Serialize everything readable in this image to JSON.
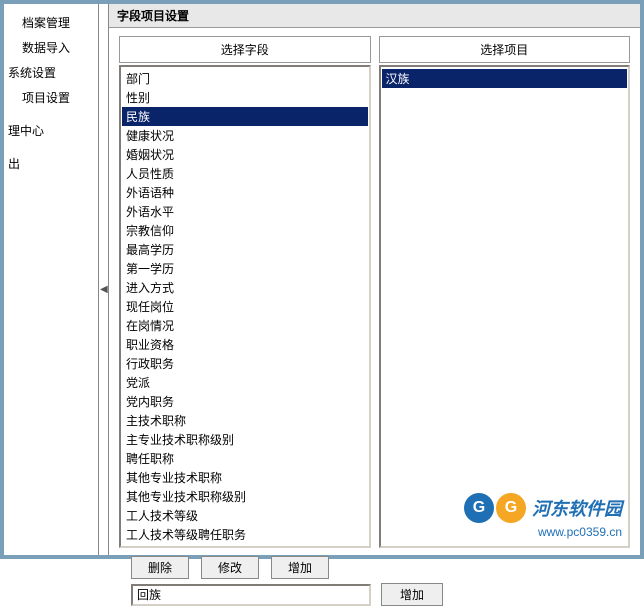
{
  "sidebar": {
    "items": [
      {
        "label": "档案管理",
        "level": 1
      },
      {
        "label": "数据导入",
        "level": 1
      },
      {
        "label": "系统设置",
        "level": 0
      },
      {
        "label": "项目设置",
        "level": 1
      },
      {
        "label": "理中心",
        "level": 0
      },
      {
        "label": "出",
        "level": 0
      }
    ]
  },
  "panel": {
    "title": "字段项目设置"
  },
  "columns": {
    "left_header": "选择字段",
    "right_header": "选择项目"
  },
  "fields": [
    "部门",
    "性别",
    "民族",
    "健康状况",
    "婚姻状况",
    "人员性质",
    "外语语种",
    "外语水平",
    "宗教信仰",
    "最高学历",
    "第一学历",
    "进入方式",
    "现任岗位",
    "在岗情况",
    "职业资格",
    "行政职务",
    "党派",
    "党内职务",
    "主技术职称",
    "主专业技术职称级别",
    "聘任职称",
    "其他专业技术职称",
    "其他专业技术职称级别",
    "工人技术等级",
    "工人技术等级聘任职务"
  ],
  "fields_selected_index": 2,
  "items": [
    "汉族"
  ],
  "items_selected_index": 0,
  "buttons": {
    "delete": "删除",
    "modify": "修改",
    "add": "增加"
  },
  "input": {
    "value": "回族",
    "add_label": "增加"
  },
  "watermark": {
    "name": "河东软件园",
    "url": "www.pc0359.cn"
  }
}
